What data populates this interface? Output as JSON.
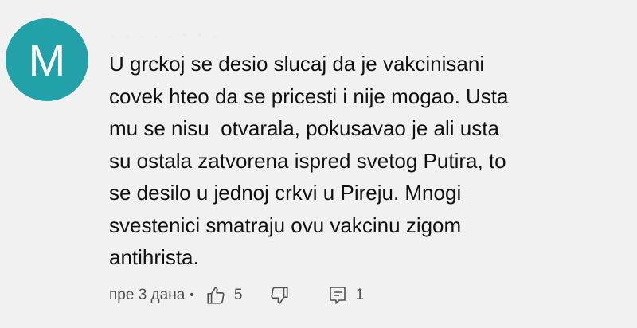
{
  "comment": {
    "avatar_letter": "M",
    "avatar_color": "#22a1a8",
    "author_obscured": ". . . . . - - .",
    "text_lines": [
      "U grckoj se desio slucaj da je vakcinisani",
      "covek hteo da se pricesti i nije mogao. Usta",
      "mu se nisu  otvarala, pokusavao je ali usta",
      "su ostala zatvorena ispred svetog Putira, to",
      "se desilo u jednoj crkvi u Pireju. Mnogi",
      "svestenici smatraju ovu vakcinu zigom",
      "antihrista."
    ],
    "timestamp": "пре 3 дана",
    "separator": "•",
    "like_count": "5",
    "reply_count": "1",
    "icons": {
      "like": "thumbs-up-icon",
      "dislike": "thumbs-down-icon",
      "reply": "reply-comment-icon"
    }
  }
}
